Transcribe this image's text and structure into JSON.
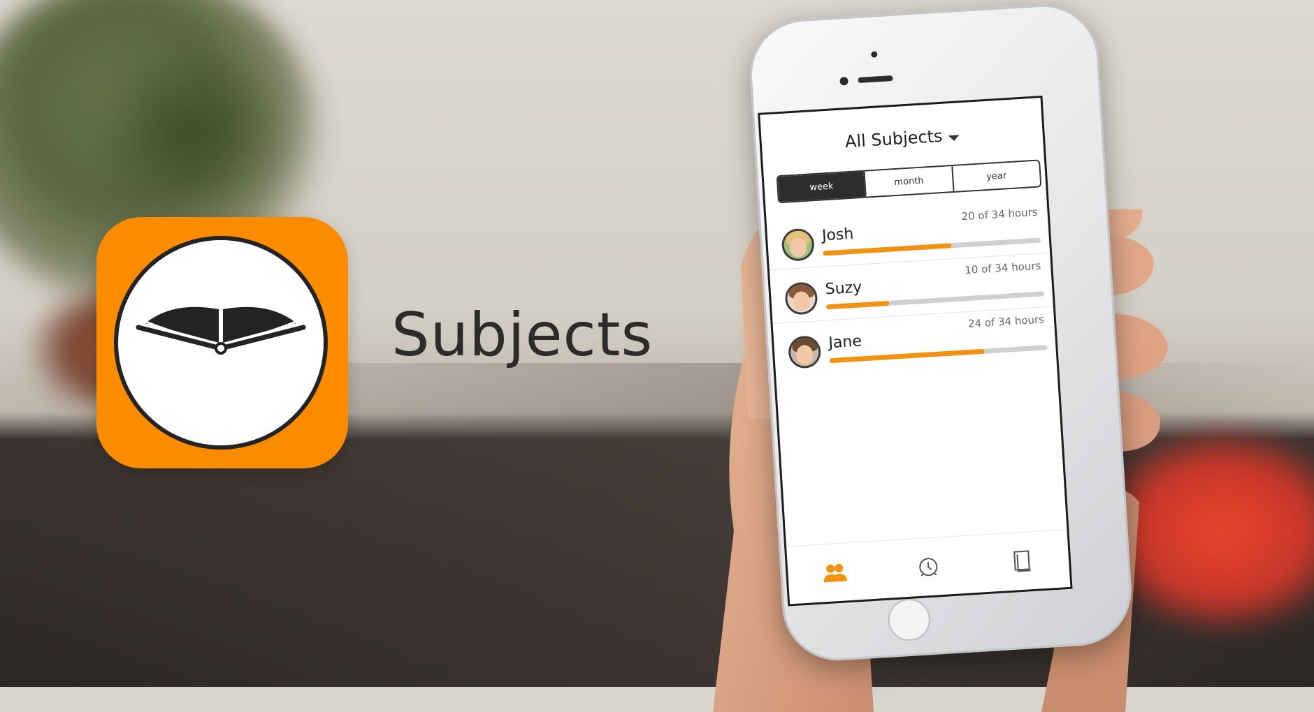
{
  "app": {
    "name": "Subjects",
    "accent_color": "#fb8c00",
    "icon": "book-clock-icon"
  },
  "screen": {
    "title": "All Subjects",
    "title_icon": "caret-down-icon",
    "segments": [
      {
        "label": "week",
        "active": true
      },
      {
        "label": "month",
        "active": false
      },
      {
        "label": "year",
        "active": false
      }
    ],
    "students": [
      {
        "name": "Josh",
        "hours_text": "20 of 34 hours",
        "progress": 0.59,
        "avatar": "josh-avatar"
      },
      {
        "name": "Suzy",
        "hours_text": "10 of 34 hours",
        "progress": 0.29,
        "avatar": "suzy-avatar"
      },
      {
        "name": "Jane",
        "hours_text": "24 of 34 hours",
        "progress": 0.71,
        "avatar": "jane-avatar"
      }
    ],
    "tabbar": [
      {
        "icon": "students-icon",
        "active": true,
        "color": "#f39211"
      },
      {
        "icon": "timer-icon",
        "active": false,
        "color": "#555555"
      },
      {
        "icon": "subjects-book-icon",
        "active": false,
        "color": "#555555"
      }
    ]
  }
}
